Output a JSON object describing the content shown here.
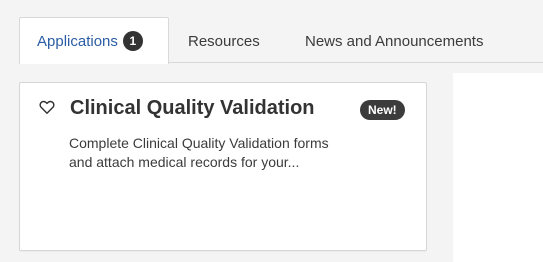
{
  "tabs": [
    {
      "label": "Applications",
      "count": "1",
      "active": true
    },
    {
      "label": "Resources",
      "active": false
    },
    {
      "label": "News and Announcements",
      "active": false
    }
  ],
  "card": {
    "favorite_icon": "heart-outline-icon",
    "title": "Clinical Quality Validation",
    "badge": "New!",
    "description": "Complete Clinical Quality Validation forms and attach medical records for your..."
  },
  "colors": {
    "active_tab_text": "#2b5da6",
    "badge_bg": "#333333",
    "page_bg": "#f4f4f4",
    "card_border": "#d6d6d6"
  }
}
